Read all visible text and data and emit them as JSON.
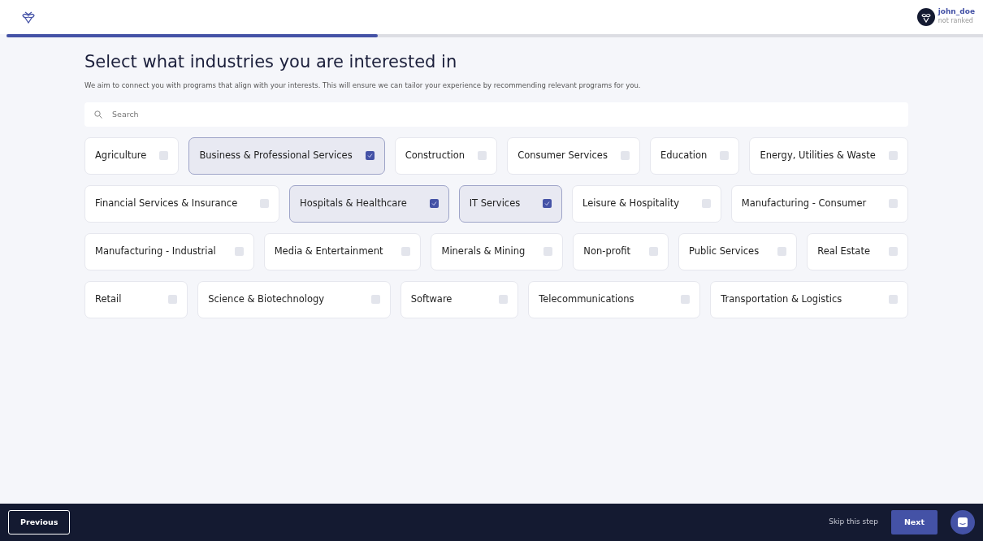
{
  "user": {
    "name": "john_doe",
    "rank": "not ranked"
  },
  "progress": {
    "level": 0.38
  },
  "title": "Select what industries you are interested in",
  "subtitle": "We aim to connect you with programs that align with your interests. This will ensure we can tailor your experience by recommending relevant programs for you.",
  "search": {
    "placeholder": "Search"
  },
  "industry_rows": [
    [
      {
        "label": "Agriculture",
        "checked": false
      },
      {
        "label": "Business & Professional Services",
        "checked": true
      },
      {
        "label": "Construction",
        "checked": false
      },
      {
        "label": "Consumer Services",
        "checked": false
      },
      {
        "label": "Education",
        "checked": false
      },
      {
        "label": "Energy, Utilities & Waste",
        "checked": false
      }
    ],
    [
      {
        "label": "Financial Services & Insurance",
        "checked": false
      },
      {
        "label": "Hospitals & Healthcare",
        "checked": true
      },
      {
        "label": "IT Services",
        "checked": true
      },
      {
        "label": "Leisure & Hospitality",
        "checked": false
      },
      {
        "label": "Manufacturing - Consumer",
        "checked": false
      }
    ],
    [
      {
        "label": "Manufacturing - Industrial",
        "checked": false
      },
      {
        "label": "Media & Entertainment",
        "checked": false
      },
      {
        "label": "Minerals & Mining",
        "checked": false
      },
      {
        "label": "Non-profit",
        "checked": false
      },
      {
        "label": "Public Services",
        "checked": false
      },
      {
        "label": "Real Estate",
        "checked": false
      }
    ],
    [
      {
        "label": "Retail",
        "checked": false
      },
      {
        "label": "Science & Biotechnology",
        "checked": false
      },
      {
        "label": "Software",
        "checked": false
      },
      {
        "label": "Telecommunications",
        "checked": false
      },
      {
        "label": "Transportation & Logistics",
        "checked": false
      }
    ]
  ],
  "footer": {
    "previous": "Previous",
    "skip": "Skip this step",
    "next": "Next"
  }
}
